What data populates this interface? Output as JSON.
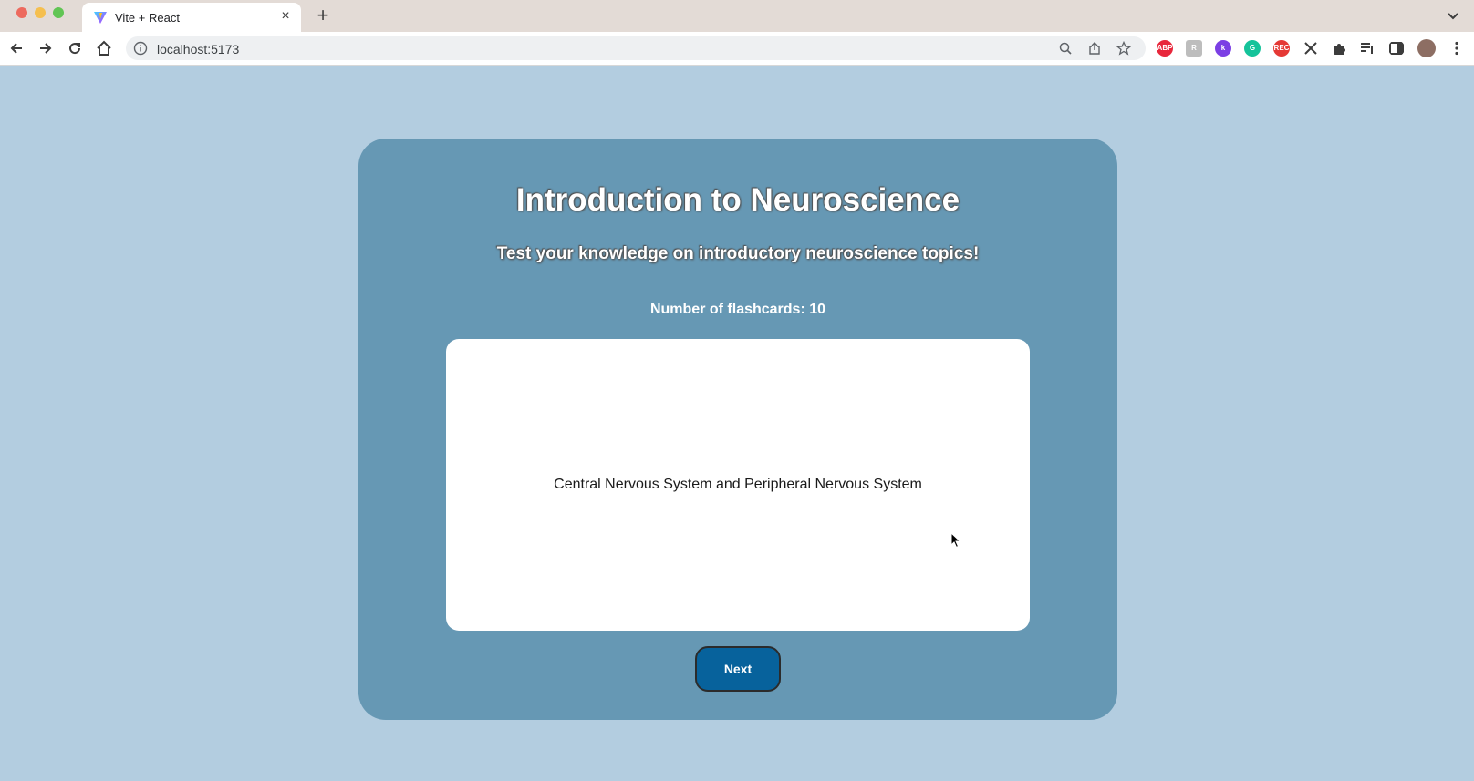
{
  "browser": {
    "tab_title": "Vite + React",
    "new_tab_label": "+",
    "url": "localhost:5173",
    "extensions": [
      {
        "name": "adblock-plus",
        "label": "ABP",
        "color": "#e8273b"
      },
      {
        "name": "readwise",
        "label": "R",
        "color": "#bdbdbd"
      },
      {
        "name": "klarna",
        "label": "k",
        "color": "#7b3fe4"
      },
      {
        "name": "grammarly",
        "label": "G",
        "color": "#15c39a"
      },
      {
        "name": "recorder",
        "label": "REC",
        "color": "#e53935"
      }
    ]
  },
  "page": {
    "title": "Introduction to Neuroscience",
    "subtitle": "Test your knowledge on introductory neuroscience topics!",
    "count_label": "Number of flashcards: 10",
    "card_text": "Central Nervous System and Peripheral Nervous System",
    "next_label": "Next"
  },
  "colors": {
    "page_bg": "#b3cde0",
    "card_container": "#6698b4",
    "next_button": "#07629c"
  }
}
